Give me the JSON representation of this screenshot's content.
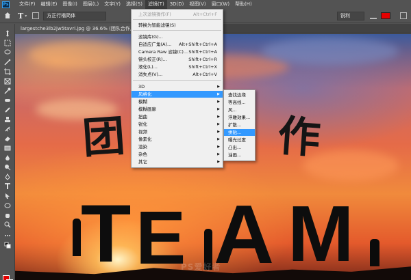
{
  "menubar": {
    "logo": "Ps",
    "items": [
      "文件(F)",
      "编辑(E)",
      "图像(I)",
      "图层(L)",
      "文字(Y)",
      "选择(S)",
      "滤镜(T)",
      "3D(D)",
      "视图(V)",
      "窗口(W)",
      "帮助(H)"
    ],
    "active_index": 6
  },
  "options": {
    "tool": "T",
    "font_family": "方正行楷简体",
    "antialias": "锐利",
    "text_color": "#e50000"
  },
  "document_tab": "largestche3lb2jw5tavri.jpg @ 36.6% (团队合作, RGB/8*)",
  "canvas": {
    "text_glyphs": [
      "团",
      "作"
    ],
    "team_letters": [
      "T",
      "E",
      "A",
      "M"
    ],
    "watermark": "PS爱好者"
  },
  "filter_menu": {
    "items": [
      {
        "label": "上次滤镜操作(F)",
        "shortcut": "Alt+Ctrl+F",
        "disabled": true
      },
      {
        "label": "转换为智能滤镜(S)",
        "shortcut": ""
      },
      {
        "label": "滤镜库(G)...",
        "shortcut": ""
      },
      {
        "label": "自适应广角(A)...",
        "shortcut": "Alt+Shift+Ctrl+A"
      },
      {
        "label": "Camera Raw 滤镜(C)...",
        "shortcut": "Shift+Ctrl+A"
      },
      {
        "label": "镜头校正(R)...",
        "shortcut": "Shift+Ctrl+R"
      },
      {
        "label": "液化(L)...",
        "shortcut": "Shift+Ctrl+X"
      },
      {
        "label": "消失点(V)...",
        "shortcut": "Alt+Ctrl+V"
      },
      {
        "label": "3D",
        "submenu": true
      },
      {
        "label": "风格化",
        "submenu": true,
        "highlighted": true
      },
      {
        "label": "模糊",
        "submenu": true
      },
      {
        "label": "模糊画廊",
        "submenu": true
      },
      {
        "label": "扭曲",
        "submenu": true
      },
      {
        "label": "锐化",
        "submenu": true
      },
      {
        "label": "视频",
        "submenu": true
      },
      {
        "label": "像素化",
        "submenu": true
      },
      {
        "label": "渲染",
        "submenu": true
      },
      {
        "label": "杂色",
        "submenu": true
      },
      {
        "label": "其它",
        "submenu": true
      }
    ]
  },
  "stylize_submenu": {
    "items": [
      "查找边缘",
      "等高线...",
      "风...",
      "浮雕效果...",
      "扩散...",
      "拼贴...",
      "曝光过度",
      "凸出...",
      "油画..."
    ],
    "highlighted_index": 5
  },
  "colors": {
    "foreground": "#e50000",
    "background": "#111111",
    "highlight": "#3399ff"
  }
}
